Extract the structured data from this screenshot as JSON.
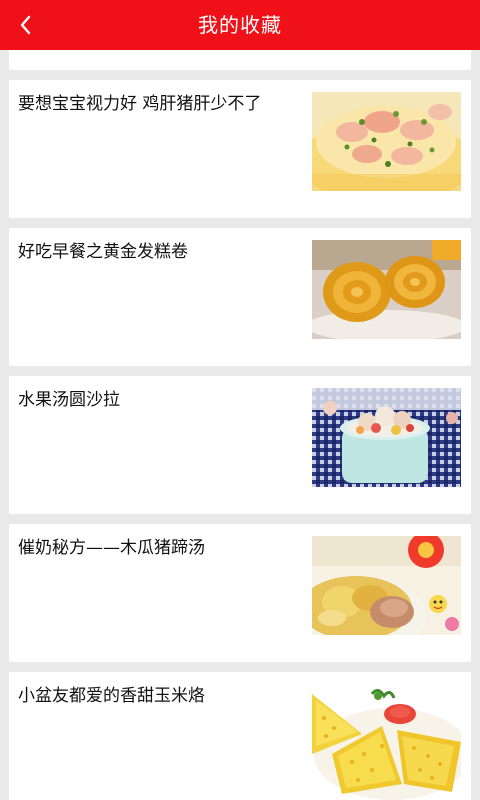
{
  "header": {
    "title": "我的收藏",
    "back_icon": "chevron-left-icon"
  },
  "favorites": [
    {
      "title": "要想宝宝视力好 鸡肝猪肝少不了",
      "image": "egg-custard-with-shrimp-photo"
    },
    {
      "title": "好吃早餐之黄金发糕卷",
      "image": "golden-sponge-roll-photo"
    },
    {
      "title": "水果汤圆沙拉",
      "image": "fruit-rice-ball-salad-photo"
    },
    {
      "title": "催奶秘方——木瓜猪蹄汤",
      "image": "papaya-pork-trotter-soup-photo"
    },
    {
      "title": "小盆友都爱的香甜玉米烙",
      "image": "sweet-corn-pancake-photo"
    }
  ],
  "colors": {
    "header_bg": "#f01018",
    "page_bg": "#e9e9e9",
    "card_bg": "#ffffff"
  }
}
